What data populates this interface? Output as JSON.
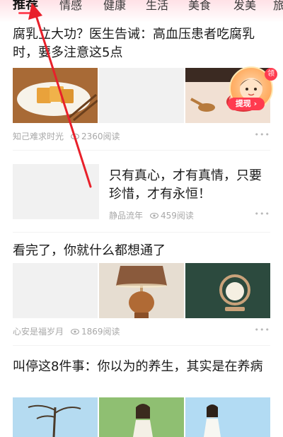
{
  "tabs": [
    {
      "label": "推荐",
      "active": true
    },
    {
      "label": "情感",
      "active": false
    },
    {
      "label": "健康",
      "active": false
    },
    {
      "label": "生活",
      "active": false
    },
    {
      "label": "美食",
      "active": false
    },
    {
      "label": "发美",
      "active": false
    },
    {
      "label": "旅",
      "active": false
    }
  ],
  "articles": [
    {
      "title": "腐乳立大功？医生告诫：高血压患者吃腐乳时，要多注意这5点",
      "source": "知己难求时光",
      "reads": "2360阅读",
      "more": "•••"
    },
    {
      "title": "只有真心，才有真情，只要珍惜，才有永恒！",
      "source": "静品流年",
      "reads": "459阅读",
      "more": "•••"
    },
    {
      "title": "看完了，你就什么都想通了",
      "source": "心安是福岁月",
      "reads": "1869阅读",
      "more": "•••"
    },
    {
      "title": "叫停这8件事：你以为的养生，其实是在养病"
    }
  ],
  "widget": {
    "button_label": "提现",
    "badge": "领"
  },
  "colors": {
    "accent": "#ff3b4f",
    "annotation": "#e8202a"
  }
}
